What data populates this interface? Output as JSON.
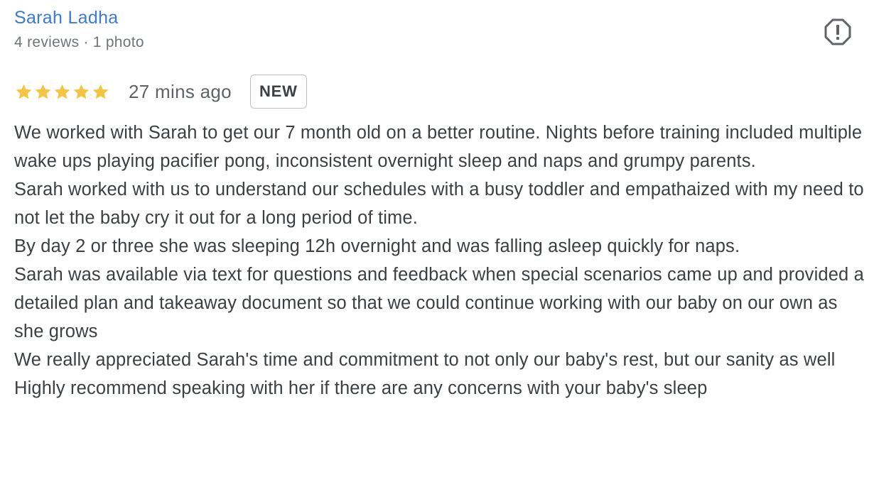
{
  "author": {
    "name": "Sarah Ladha",
    "reviews_count": "4 reviews",
    "separator": "·",
    "photos_count": "1 photo"
  },
  "review": {
    "rating": 5,
    "time_ago": "27 mins ago",
    "badge": "NEW",
    "paragraphs": [
      "We worked with Sarah to get our 7 month old on a better routine. Nights before training included multiple wake ups playing pacifier pong, inconsistent overnight sleep and naps and grumpy parents.",
      "Sarah worked with us to understand our schedules with a busy toddler and empathaized with my need to not let the baby cry it out for a long period of time.",
      "By day 2 or three she was sleeping 12h overnight and was falling asleep quickly for naps.",
      "Sarah was available via text for questions and feedback when special scenarios came up and provided a detailed plan and takeaway document so that we could continue working with our baby on our own as she grows",
      "We really appreciated Sarah's time and commitment to not only our baby's rest, but our sanity as well",
      "Highly recommend speaking with her if there are any concerns with your baby's sleep"
    ]
  },
  "icons": {
    "report": "report-flag-icon",
    "star": "star-icon"
  },
  "colors": {
    "author_link": "#3a7bd5",
    "star": "#f4c542",
    "meta_text": "#70757a",
    "body_text": "#3c4043",
    "badge_border": "#bdc1c6"
  }
}
